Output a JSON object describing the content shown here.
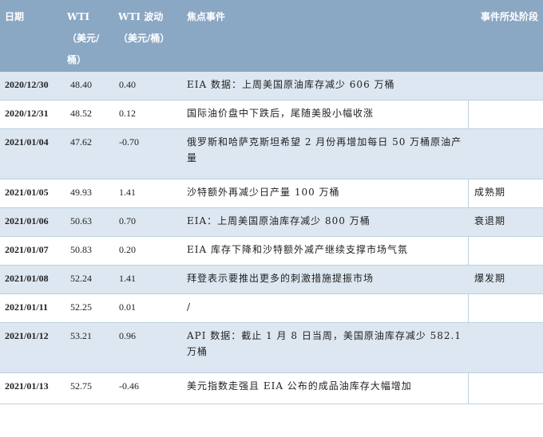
{
  "header": {
    "date": "日期",
    "wti_line1": "WTI",
    "wti_line2": "（美元/",
    "wti_line3": "桶）",
    "vol_line1": "WTI 波动",
    "vol_line2": "（美元/桶）",
    "focus": "焦点事件",
    "stage": "事件所处阶段"
  },
  "rows": [
    {
      "date": "2020/12/30",
      "wti": "48.40",
      "vol": "0.40",
      "focus": "EIA 数据：上周美国原油库存减少 606 万桶",
      "stage": ""
    },
    {
      "date": "2020/12/31",
      "wti": "48.52",
      "vol": "0.12",
      "focus": "国际油价盘中下跌后，尾随美股小幅收涨",
      "stage": ""
    },
    {
      "date": "2021/01/04",
      "wti": "47.62",
      "vol": "-0.70",
      "focus": "俄罗斯和哈萨克斯坦希望 2 月份再增加每日 50 万桶原油产量",
      "stage": ""
    },
    {
      "date": "2021/01/05",
      "wti": "49.93",
      "vol": "1.41",
      "focus": "沙特额外再减少日产量 100 万桶",
      "stage": "成熟期"
    },
    {
      "date": "2021/01/06",
      "wti": "50.63",
      "vol": "0.70",
      "focus": "EIA：上周美国原油库存减少 800 万桶",
      "stage": "衰退期"
    },
    {
      "date": "2021/01/07",
      "wti": "50.83",
      "vol": "0.20",
      "focus": "EIA 库存下降和沙特额外减产继续支撑市场气氛",
      "stage": ""
    },
    {
      "date": "2021/01/08",
      "wti": "52.24",
      "vol": "1.41",
      "focus": "拜登表示要推出更多的刺激措施提振市场",
      "stage": "爆发期"
    },
    {
      "date": "2021/01/11",
      "wti": "52.25",
      "vol": "0.01",
      "focus": "/",
      "stage": ""
    },
    {
      "date": "2021/01/12",
      "wti": "53.21",
      "vol": "0.96",
      "focus": "API 数据：截止 1 月 8 日当周，美国原油库存减少 582.1 万桶",
      "stage": ""
    },
    {
      "date": "2021/01/13",
      "wti": "52.75",
      "vol": "-0.46",
      "focus": "美元指数走强且 EIA 公布的成品油库存大幅增加",
      "stage": ""
    }
  ]
}
